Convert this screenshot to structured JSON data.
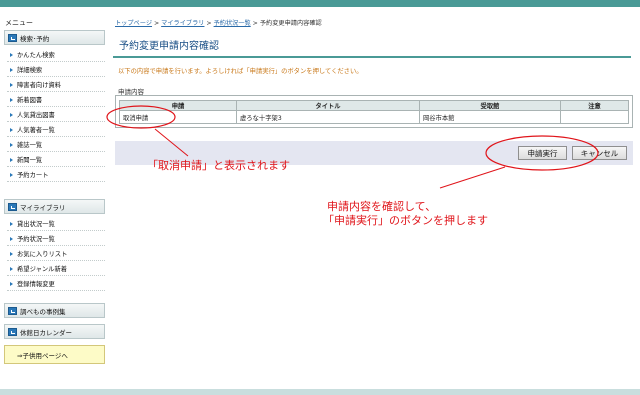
{
  "sidebar": {
    "title": "メニュー",
    "sections": [
      {
        "label": "検索･予約",
        "items": [
          "かんたん検索",
          "詳細検索",
          "障害者向け資料",
          "新着図書",
          "人気貸出図書",
          "人気著者一覧",
          "雑誌一覧",
          "新聞一覧",
          "予約カート"
        ]
      },
      {
        "label": "マイライブラリ",
        "items": [
          "貸出状況一覧",
          "予約状況一覧",
          "お気に入りリスト",
          "希望ジャンル新着",
          "登録情報変更"
        ]
      },
      {
        "label": "調べもの事例集",
        "items": []
      },
      {
        "label": "休館日カレンダー",
        "items": []
      }
    ],
    "kids_link": "⇒子供用ページへ"
  },
  "breadcrumb": {
    "links": [
      "トップページ",
      "マイライブラリ",
      "予約状況一覧"
    ],
    "separator": ">",
    "current": "予約変更申請内容確認"
  },
  "page_title": "予約変更申請内容確認",
  "notice": "以下の内容で申請を行います。よろしければ「申請実行」のボタンを押してください。",
  "request_box": {
    "label": "申請内容",
    "headers": [
      "申請",
      "タイトル",
      "受取館",
      "注意"
    ],
    "rows": [
      [
        "取消申請",
        "虚ろな十字架3",
        "岡谷市本館",
        ""
      ]
    ]
  },
  "buttons": {
    "execute": "申請実行",
    "cancel": "キャンセル"
  },
  "annotations": {
    "left": "「取消申請」と表示されます",
    "right_line1": "申請内容を確認して、",
    "right_line2": "「申請実行」のボタンを押します"
  },
  "colors": {
    "accent": "#4a9a96",
    "annotation": "#e0141a",
    "notice": "#c9791b",
    "title": "#1a4f86"
  }
}
